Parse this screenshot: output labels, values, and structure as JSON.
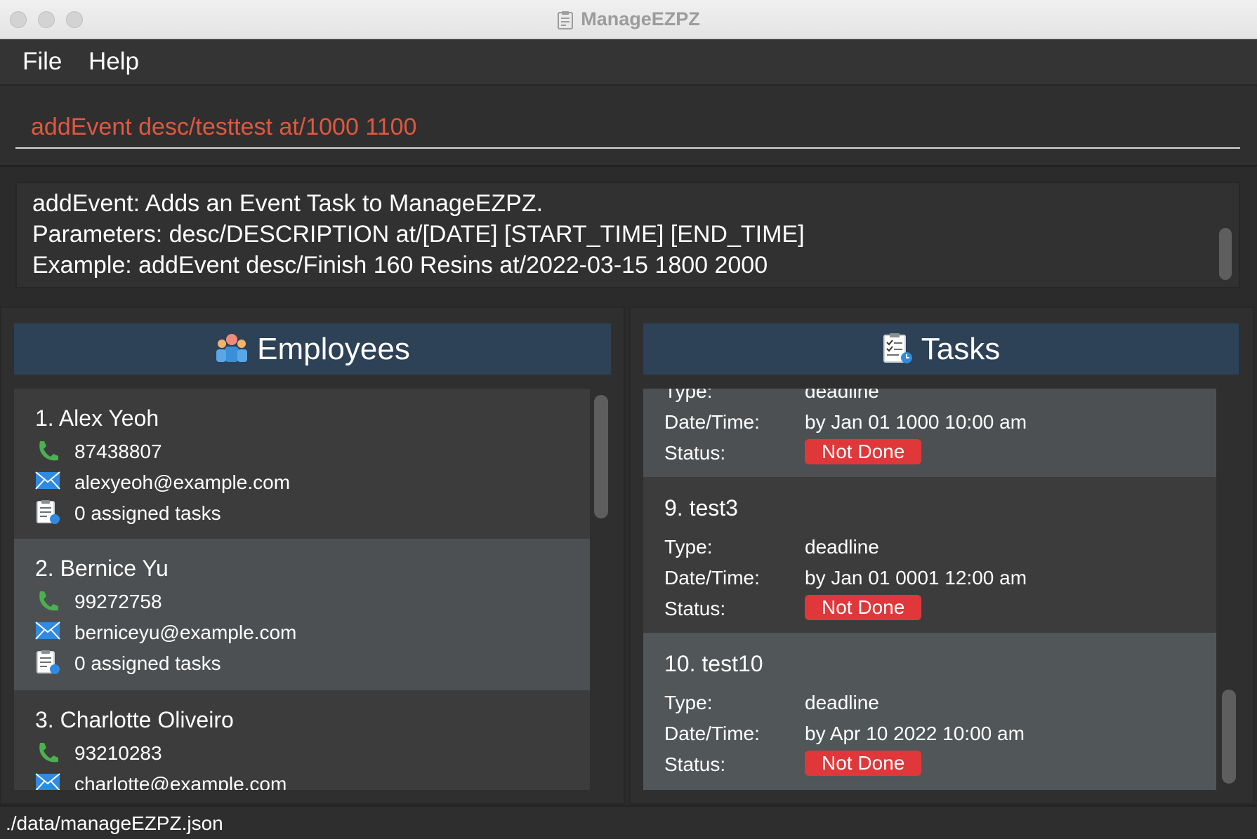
{
  "window": {
    "title": "ManageEZPZ"
  },
  "menu": {
    "file": "File",
    "help": "Help"
  },
  "command": {
    "value": "addEvent desc/testtest at/1000 1100"
  },
  "result": {
    "lines": [
      "addEvent: Adds an Event Task to ManageEZPZ.",
      "Parameters: desc/DESCRIPTION at/[DATE] [START_TIME] [END_TIME]",
      "Example: addEvent desc/Finish 160 Resins at/2022-03-15 1800 2000"
    ]
  },
  "employees": {
    "header": "Employees",
    "items": [
      {
        "name": "1.  Alex Yeoh",
        "phone": "87438807",
        "email": "alexyeoh@example.com",
        "tasks": "0 assigned tasks"
      },
      {
        "name": "2.  Bernice Yu",
        "phone": "99272758",
        "email": "berniceyu@example.com",
        "tasks": "0 assigned tasks"
      },
      {
        "name": "3.  Charlotte Oliveiro",
        "phone": "93210283",
        "email": "charlotte@example.com"
      }
    ]
  },
  "tasks": {
    "header": "Tasks",
    "labels": {
      "type": "Type:",
      "datetime": "Date/Time:",
      "status": "Status:"
    },
    "partial": {
      "type": "deadline",
      "datetime": "by Jan 01 1000 10:00 am",
      "status": "Not Done"
    },
    "items": [
      {
        "title": "9.  test3",
        "type": "deadline",
        "datetime": "by Jan 01 0001 12:00 am",
        "status": "Not Done"
      },
      {
        "title": "10.  test10",
        "type": "deadline",
        "datetime": "by Apr 10 2022 10:00 am",
        "status": "Not Done"
      }
    ]
  },
  "statusbar": {
    "path": "./data/manageEZPZ.json"
  },
  "colors": {
    "accent_header": "#2d4157",
    "command_text": "#e0583f",
    "badge_red": "#e0383a",
    "phone_green": "#4caf50",
    "mail_blue": "#2f8ae0"
  }
}
